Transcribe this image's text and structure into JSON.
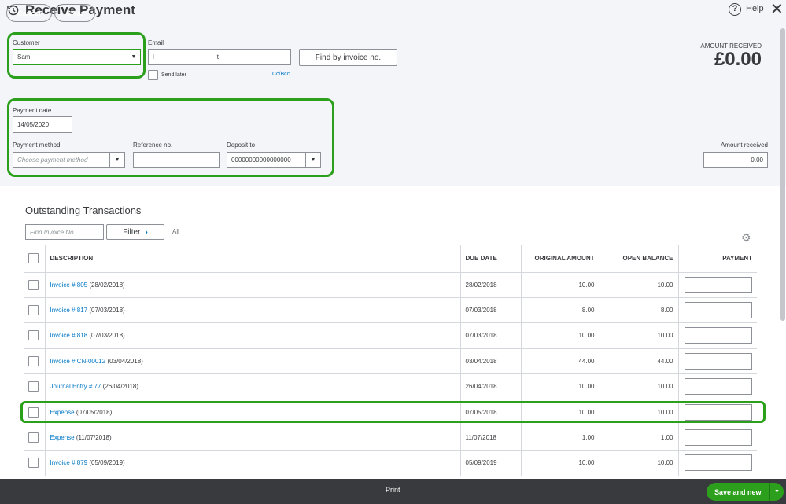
{
  "header": {
    "title": "Receive Payment",
    "help": "Help"
  },
  "customer": {
    "label": "Customer",
    "value": "Sam"
  },
  "email": {
    "label": "Email",
    "value": "l                    t",
    "send_later": "Send later",
    "cc_bcc": "Cc/Bcc"
  },
  "find_invoice_btn": "Find by invoice no.",
  "amount_received_top": {
    "label": "AMOUNT RECEIVED",
    "value": "£0.00"
  },
  "payment_date": {
    "label": "Payment date",
    "value": "14/05/2020"
  },
  "payment_method": {
    "label": "Payment method",
    "placeholder": "Choose payment method"
  },
  "reference": {
    "label": "Reference no.",
    "value": ""
  },
  "deposit_to": {
    "label": "Deposit to",
    "value": "00000000000000000"
  },
  "amount_received_field": {
    "label": "Amount received",
    "value": "0.00"
  },
  "outstanding": {
    "title": "Outstanding Transactions",
    "find_placeholder": "Find Invoice No.",
    "filter": "Filter",
    "all": "All",
    "columns": [
      "DESCRIPTION",
      "DUE DATE",
      "ORIGINAL AMOUNT",
      "OPEN BALANCE",
      "PAYMENT"
    ],
    "rows": [
      {
        "link": "Invoice # 805",
        "date": "(28/02/2018)",
        "due": "28/02/2018",
        "original": "10.00",
        "open": "10.00"
      },
      {
        "link": "Invoice # 817",
        "date": "(07/03/2018)",
        "due": "07/03/2018",
        "original": "8.00",
        "open": "8.00"
      },
      {
        "link": "Invoice # 818",
        "date": "(07/03/2018)",
        "due": "07/03/2018",
        "original": "10.00",
        "open": "10.00"
      },
      {
        "link": "Invoice # CN-00012",
        "date": "(03/04/2018)",
        "due": "03/04/2018",
        "original": "44.00",
        "open": "44.00"
      },
      {
        "link": "Journal Entry # 77",
        "date": "(26/04/2018)",
        "due": "26/04/2018",
        "original": "10.00",
        "open": "10.00"
      },
      {
        "link": "Expense",
        "date": "(07/05/2018)",
        "due": "07/05/2018",
        "original": "10.00",
        "open": "10.00"
      },
      {
        "link": "Expense",
        "date": "(11/07/2018)",
        "due": "11/07/2018",
        "original": "1.00",
        "open": "1.00"
      },
      {
        "link": "Invoice # 879",
        "date": "(05/09/2019)",
        "due": "05/09/2019",
        "original": "10.00",
        "open": "10.00"
      }
    ]
  },
  "footer": {
    "cancel": "Cancel",
    "clear": "Clear",
    "print": "Print",
    "save": "Save and new"
  },
  "colors": {
    "accent": "#2ca01c",
    "link": "#0077c5",
    "footer": "#393a3d"
  }
}
